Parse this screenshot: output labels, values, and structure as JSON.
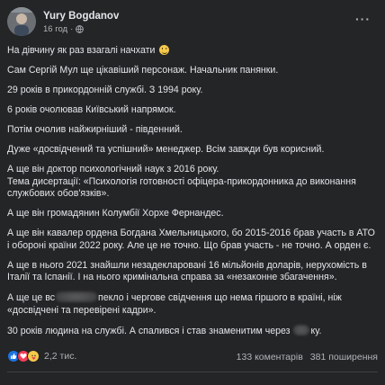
{
  "post": {
    "author": "Yury Bogdanov",
    "time": "16 год",
    "more_label": "···",
    "paragraphs": [
      "На дівчину як раз взагалі начхати",
      "Сам Сергій Мул ще цікавіший персонаж. Начальник панянки.",
      "29 років в прикордонній службі. З 1994 року.",
      "6 років очолював Київський напрямок.",
      "Потім очолив найжирніший - південний.",
      "Дуже «досвідчений та успішний» менеджер. Всім завжди був корисний.",
      "А ще він доктор психологічний наук з 2016 року.\nТема дисертації: «Психологія готовності офіцера-прикордонника до виконання службових обов'язків».",
      "А ще він громадянин Колумбії Хорхе Фернандес.",
      "А ще він кавалер ордена Богдана Хмельницького, бо 2015-2016 брав участь в АТО і обороні країни 2022 року. Але це не точно. Що брав участь - не точно. А орден є.",
      "А ще в нього 2021 знайшли незадекларовані 16 мільйонів доларів, нерухомість в Італії та Іспанії. І на нього кримінальна справа за «незаконне збагачення».",
      "А ще це вс",
      "пекло і чергове свідчення що нема гіршого в країні, ніж «досвідчені та перевірені кадри».",
      "30 років людина на службі. А спалився і став знаменитим через ",
      "ку."
    ]
  },
  "footer": {
    "reaction_count": "2,2 тис.",
    "comments": "133 коментарів",
    "shares": "381 поширення"
  },
  "icons": {
    "avatar": "avatar",
    "globe": "globe-icon",
    "smiley": "smiling-face-icon",
    "reactions": [
      "like-react-icon",
      "love-react-icon",
      "care-react-icon"
    ]
  },
  "colors": {
    "background": "#242526",
    "text_primary": "#e4e6eb",
    "text_secondary": "#b0b3b8",
    "like_blue": "#1b74e4",
    "love_red": "#f33e58",
    "care_yellow": "#f7c94b"
  }
}
